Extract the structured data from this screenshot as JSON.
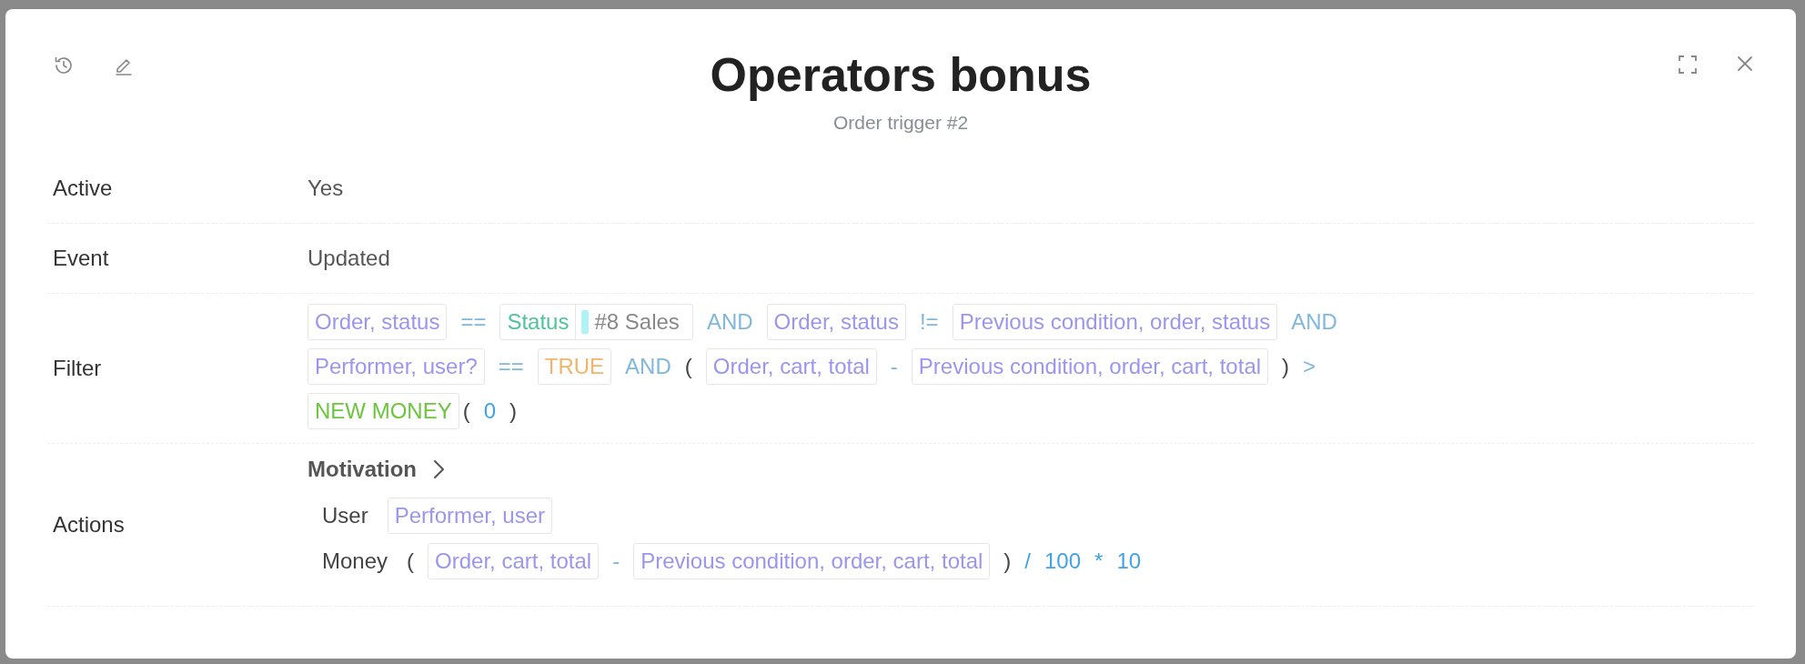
{
  "dialog": {
    "title": "Operators bonus",
    "subtitle": "Order trigger #2"
  },
  "fields": [
    {
      "label": "Active",
      "kind": "text",
      "value": "Yes"
    },
    {
      "label": "Event",
      "kind": "text",
      "value": "Updated"
    },
    {
      "label": "Filter",
      "kind": "expression",
      "lines": [
        [
          {
            "kind": "field",
            "text": "Order, status"
          },
          {
            "kind": "op",
            "text": "=="
          },
          {
            "kind": "status",
            "text": "Status",
            "value": "#8 Sales",
            "color": "#aef3f5"
          },
          {
            "kind": "op",
            "text": "AND"
          },
          {
            "kind": "field",
            "text": "Order, status"
          },
          {
            "kind": "op",
            "text": "!="
          },
          {
            "kind": "field",
            "text": "Previous condition, order, status"
          },
          {
            "kind": "op",
            "text": "AND"
          }
        ],
        [
          {
            "kind": "field",
            "text": "Performer, user?"
          },
          {
            "kind": "op",
            "text": "=="
          },
          {
            "kind": "bool",
            "text": "TRUE"
          },
          {
            "kind": "op",
            "text": "AND"
          },
          {
            "kind": "paren",
            "text": "("
          },
          {
            "kind": "field",
            "text": "Order, cart, total"
          },
          {
            "kind": "op",
            "text": "-"
          },
          {
            "kind": "field",
            "text": "Previous condition, order, cart, total"
          },
          {
            "kind": "paren",
            "text": ")"
          },
          {
            "kind": "op",
            "text": ">"
          }
        ],
        [
          {
            "kind": "func",
            "text": "NEW MONEY"
          },
          {
            "kind": "paren",
            "text": "("
          },
          {
            "kind": "number",
            "text": "0"
          },
          {
            "kind": "paren",
            "text": ")"
          }
        ]
      ]
    },
    {
      "label": "Actions",
      "kind": "actions",
      "actions": [
        {
          "title": "Motivation",
          "params": [
            {
              "label": "User",
              "tokens": [
                {
                  "kind": "field",
                  "text": "Performer, user"
                }
              ]
            },
            {
              "label": "Money",
              "tokens": [
                {
                  "kind": "paren",
                  "text": "("
                },
                {
                  "kind": "field",
                  "text": "Order, cart, total"
                },
                {
                  "kind": "op",
                  "text": "-"
                },
                {
                  "kind": "field",
                  "text": "Previous condition, order, cart, total"
                },
                {
                  "kind": "paren",
                  "text": ")"
                },
                {
                  "kind": "num-op",
                  "text": "/"
                },
                {
                  "kind": "number",
                  "text": "100"
                },
                {
                  "kind": "num-op",
                  "text": "*"
                },
                {
                  "kind": "number",
                  "text": "10"
                }
              ]
            }
          ]
        }
      ]
    }
  ]
}
